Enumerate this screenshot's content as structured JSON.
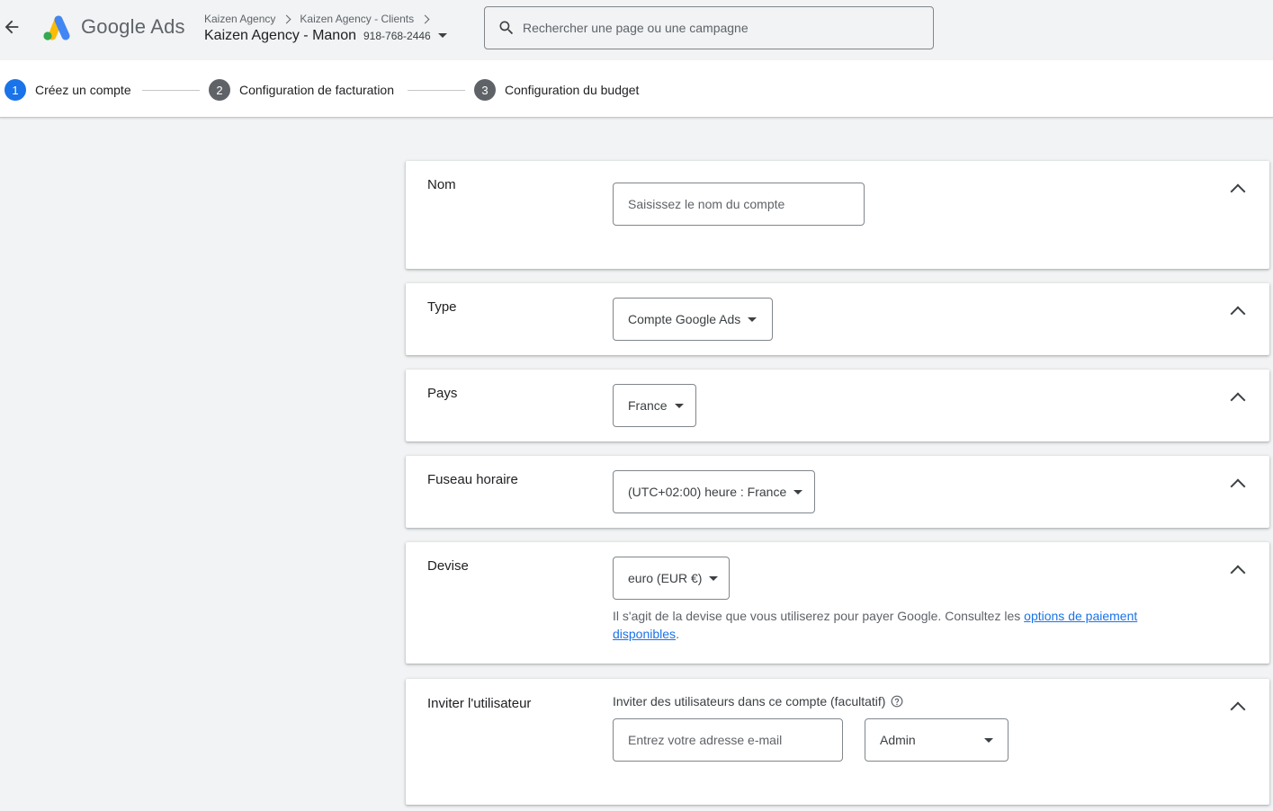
{
  "header": {
    "app_name": "Google Ads",
    "breadcrumbs": [
      "Kaizen Agency",
      "Kaizen Agency - Clients"
    ],
    "account_name": "Kaizen Agency - Manon",
    "account_id": "918-768-2446",
    "search_placeholder": "Rechercher une page ou une campagne"
  },
  "steps": [
    {
      "number": "1",
      "label": "Créez un compte"
    },
    {
      "number": "2",
      "label": "Configuration de facturation"
    },
    {
      "number": "3",
      "label": "Configuration du budget"
    }
  ],
  "sections": {
    "name": {
      "title": "Nom",
      "placeholder": "Saisissez le nom du compte"
    },
    "type": {
      "title": "Type",
      "value": "Compte Google Ads"
    },
    "country": {
      "title": "Pays",
      "value": "France"
    },
    "timezone": {
      "title": "Fuseau horaire",
      "value": "(UTC+02:00) heure : France"
    },
    "currency": {
      "title": "Devise",
      "value": "euro (EUR €)",
      "helper_text": "Il s'agit de la devise que vous utiliserez pour payer Google. Consultez les ",
      "helper_link": "options de paiement disponibles",
      "helper_end": "."
    },
    "invite": {
      "title": "Inviter l'utilisateur",
      "label": "Inviter des utilisateurs dans ce compte (facultatif)",
      "email_placeholder": "Entrez votre adresse e-mail",
      "role": "Admin"
    }
  },
  "colors": {
    "primary": "#1a73e8",
    "step_inactive": "#5f6368",
    "background": "#f1f3f4"
  },
  "icons": [
    "back-arrow-icon",
    "google-ads-logo-icon",
    "chevron-right-icon",
    "dropdown-caret-icon",
    "search-icon",
    "chevron-up-icon",
    "help-circle-icon"
  ]
}
